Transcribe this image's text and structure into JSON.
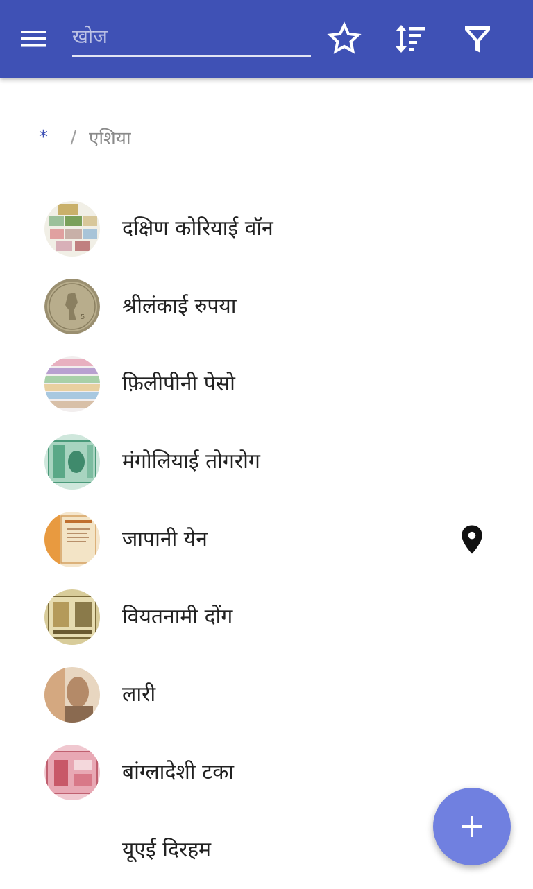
{
  "toolbar": {
    "search_placeholder": "खोज",
    "menu_icon": "hamburger-menu-icon",
    "favorite_icon": "star-outline-icon",
    "sort_icon": "sort-icon",
    "filter_icon": "filter-icon"
  },
  "breadcrumb": {
    "root": "*",
    "separator": "/",
    "current": "एशिया"
  },
  "items": [
    {
      "label": "दक्षिण कोरियाई वॉन",
      "has_thumbnail": true,
      "has_location": false
    },
    {
      "label": "श्रीलंकाई रुपया",
      "has_thumbnail": true,
      "has_location": false
    },
    {
      "label": "फ़िलीपीनी पेसो",
      "has_thumbnail": true,
      "has_location": false
    },
    {
      "label": "मंगोलियाई तोगरोग",
      "has_thumbnail": true,
      "has_location": false
    },
    {
      "label": "जापानी येन",
      "has_thumbnail": true,
      "has_location": true
    },
    {
      "label": "वियतनामी दोंग",
      "has_thumbnail": true,
      "has_location": false
    },
    {
      "label": "लारी",
      "has_thumbnail": true,
      "has_location": false
    },
    {
      "label": "बांग्लादेशी टका",
      "has_thumbnail": true,
      "has_location": false
    },
    {
      "label": "यूएई दिरहम",
      "has_thumbnail": false,
      "has_location": false
    }
  ],
  "fab": {
    "icon": "plus-icon"
  },
  "colors": {
    "app_bar": "#3f51b5",
    "accent": "#3f51b5",
    "fab": "#7080e0",
    "text_primary": "#212121",
    "text_secondary": "#8a8a8a"
  }
}
